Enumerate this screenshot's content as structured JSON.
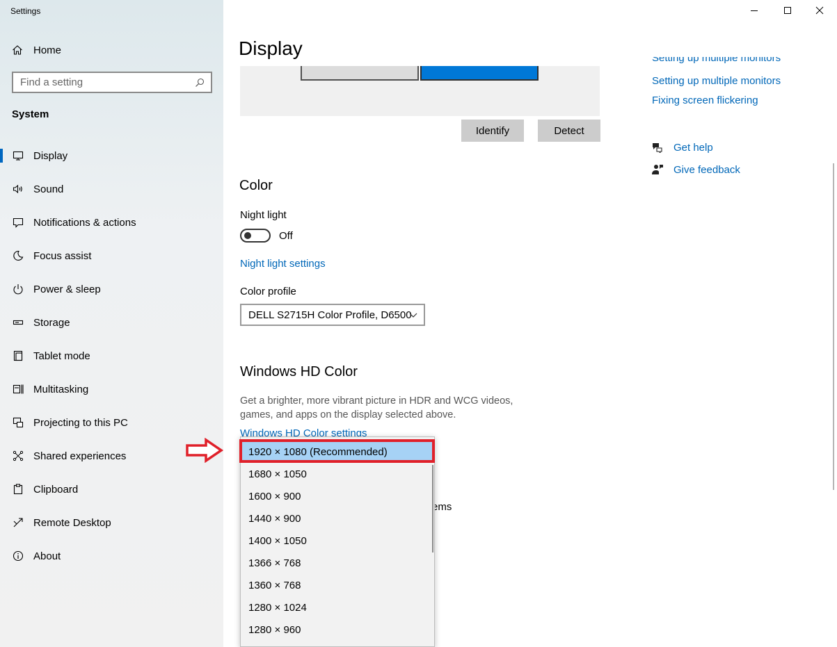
{
  "app_title": "Settings",
  "sidebar": {
    "home_label": "Home",
    "search_placeholder": "Find a setting",
    "section_label": "System",
    "items": [
      {
        "label": "Display",
        "icon": "monitor-icon"
      },
      {
        "label": "Sound",
        "icon": "speaker-icon"
      },
      {
        "label": "Notifications & actions",
        "icon": "notification-icon"
      },
      {
        "label": "Focus assist",
        "icon": "moon-icon"
      },
      {
        "label": "Power & sleep",
        "icon": "power-icon"
      },
      {
        "label": "Storage",
        "icon": "storage-icon"
      },
      {
        "label": "Tablet mode",
        "icon": "tablet-icon"
      },
      {
        "label": "Multitasking",
        "icon": "multitasking-icon"
      },
      {
        "label": "Projecting to this PC",
        "icon": "projecting-icon"
      },
      {
        "label": "Shared experiences",
        "icon": "shared-icon"
      },
      {
        "label": "Clipboard",
        "icon": "clipboard-icon"
      },
      {
        "label": "Remote Desktop",
        "icon": "remote-desktop-icon"
      },
      {
        "label": "About",
        "icon": "info-icon"
      }
    ]
  },
  "main": {
    "title": "Display",
    "identify_label": "Identify",
    "detect_label": "Detect",
    "color_heading": "Color",
    "night_light_label": "Night light",
    "night_light_state": "Off",
    "night_light_settings_link": "Night light settings",
    "color_profile_label": "Color profile",
    "color_profile_value": "DELL S2715H Color Profile, D6500",
    "hd_heading": "Windows HD Color",
    "hd_desc_line1": "Get a brighter, more vibrant picture in HDR and WCG videos,",
    "hd_desc_line2": "games, and apps on the display selected above.",
    "hd_settings_link": "Windows HD Color settings",
    "partial_text": "ems"
  },
  "related": {
    "link_partial": "Setting up multiple monitors",
    "link_multiple": "Setting up multiple monitors",
    "link_flicker": "Fixing screen flickering",
    "get_help": "Get help",
    "give_feedback": "Give feedback"
  },
  "resolution_dropdown": {
    "selected": "1920 × 1080 (Recommended)",
    "options": [
      "1920 × 1080 (Recommended)",
      "1680 × 1050",
      "1600 × 900",
      "1440 × 900",
      "1400 × 1050",
      "1366 × 768",
      "1360 × 768",
      "1280 × 1024",
      "1280 × 960"
    ]
  },
  "colors": {
    "accent": "#0067b8",
    "highlight_border": "#e0202a",
    "selected_bg": "#a6d2f5",
    "monitor_selected": "#0078d7"
  }
}
